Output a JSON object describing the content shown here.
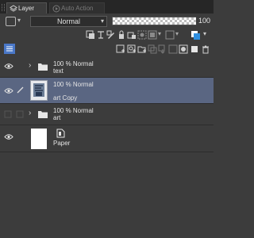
{
  "tabs": {
    "layer_label": "Layer",
    "auto_action_label": "Auto Action"
  },
  "toolbar": {
    "blend_mode": "Normal",
    "opacity_value": "100"
  },
  "layers": [
    {
      "opacity_mode": "100 % Normal",
      "name": "text",
      "type": "folder",
      "selected": false,
      "visible": true
    },
    {
      "opacity_mode": "100 % Normal",
      "name": "art Copy",
      "type": "raster",
      "selected": true,
      "visible": true
    },
    {
      "opacity_mode": "100 % Normal",
      "name": "art",
      "type": "folder",
      "selected": false,
      "visible": false
    },
    {
      "opacity_mode": "",
      "name": "Paper",
      "type": "paper",
      "selected": false,
      "visible": true
    }
  ],
  "colors": {
    "panel_bg": "#3c3c3c",
    "selected_row": "#5a6682",
    "tab_bar": "#262626"
  }
}
